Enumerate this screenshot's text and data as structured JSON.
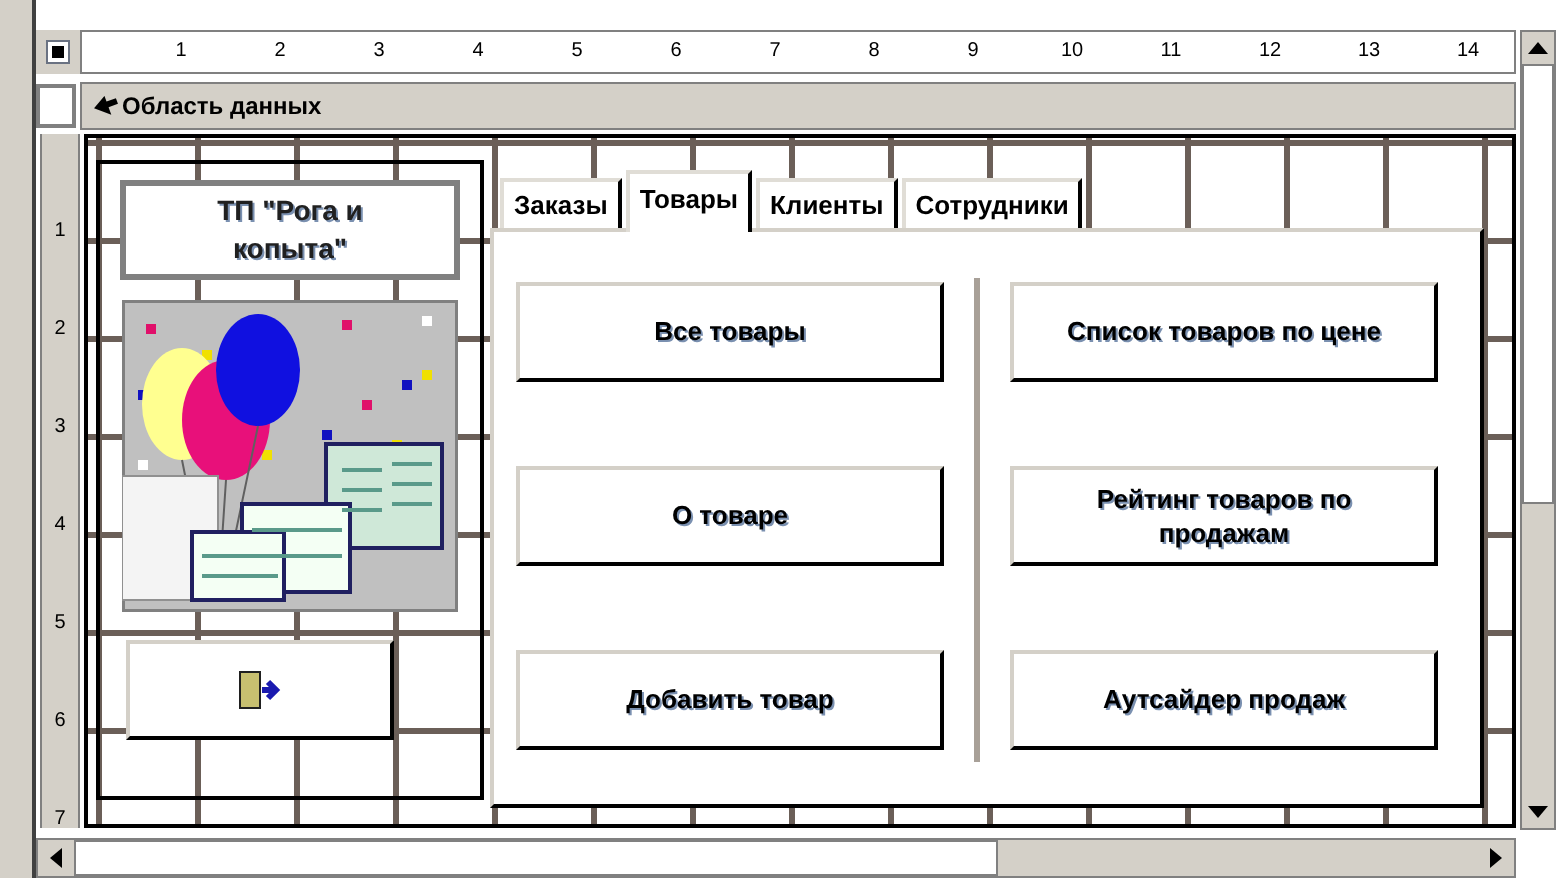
{
  "rulers": {
    "horizontal": [
      "1",
      "2",
      "3",
      "4",
      "5",
      "6",
      "7",
      "8",
      "9",
      "10",
      "11",
      "12",
      "13",
      "14"
    ],
    "vertical": [
      "1",
      "2",
      "3",
      "4",
      "5",
      "6",
      "7"
    ]
  },
  "section_header": {
    "title": "Область данных"
  },
  "form": {
    "title_label": "ТП \"Рога и копыта\"",
    "tabs": [
      {
        "label": "Заказы",
        "selected": false
      },
      {
        "label": "Товары",
        "selected": true
      },
      {
        "label": "Клиенты",
        "selected": false
      },
      {
        "label": "Сотрудники",
        "selected": false
      }
    ],
    "buttons_left": [
      "Все товары",
      "О товаре",
      "Добавить товар"
    ],
    "buttons_right": [
      "Список товаров по цене",
      "Рейтинг товаров по продажам",
      "Аутсайдер продаж"
    ]
  }
}
